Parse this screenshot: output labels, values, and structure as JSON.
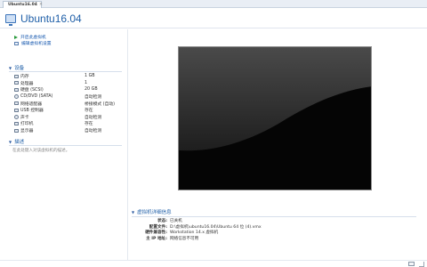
{
  "tab": {
    "label": "Ubuntu16.04",
    "close": "×"
  },
  "header": {
    "title": "Ubuntu16.04"
  },
  "actions": [
    {
      "label": "开启此虚拟机",
      "icon": "play-icon"
    },
    {
      "label": "编辑虚拟机设置",
      "icon": "edit-settings-icon"
    }
  ],
  "devices": {
    "title": "设备",
    "items": [
      {
        "name": "内存",
        "value": "1 GB",
        "icon": "memory-icon"
      },
      {
        "name": "处理器",
        "value": "1",
        "icon": "processor-icon"
      },
      {
        "name": "硬盘 (SCSI)",
        "value": "20 GB",
        "icon": "hard-disk-icon"
      },
      {
        "name": "CD/DVD (SATA)",
        "value": "自动检测",
        "icon": "cd-dvd-icon"
      },
      {
        "name": "网络适配器",
        "value": "桥接模式 (自动)",
        "icon": "network-adapter-icon"
      },
      {
        "name": "USB 控制器",
        "value": "存在",
        "icon": "usb-icon"
      },
      {
        "name": "声卡",
        "value": "自动检测",
        "icon": "sound-card-icon"
      },
      {
        "name": "打印机",
        "value": "存在",
        "icon": "printer-icon"
      },
      {
        "name": "显示器",
        "value": "自动检测",
        "icon": "display-icon"
      }
    ]
  },
  "description": {
    "title": "描述",
    "placeholder": "在此处键入对该虚拟机的描述。"
  },
  "details": {
    "title": "虚拟机详细信息",
    "rows": [
      {
        "key": "状态:",
        "value": "已关机"
      },
      {
        "key": "配置文件:",
        "value": "D:\\虚拟机\\ubuntu16.04\\Ubuntu 64 位 (4).vmx"
      },
      {
        "key": "硬件兼容性:",
        "value": "Workstation 14.x 虚拟机"
      },
      {
        "key": "主 IP 地址:",
        "value": "网络信息不可用"
      }
    ]
  }
}
